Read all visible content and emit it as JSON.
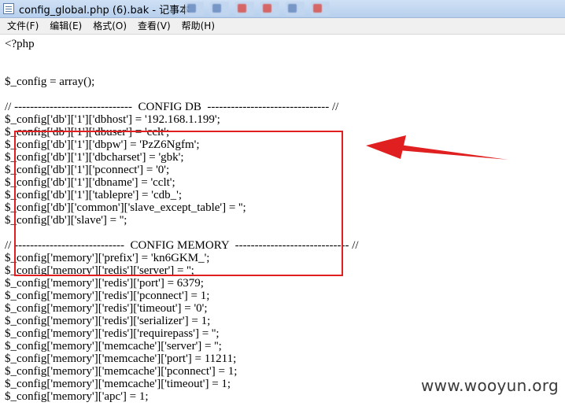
{
  "window": {
    "title": "config_global.php (6).bak - 记事本",
    "background_tabs": [
      "",
      "",
      "",
      "",
      "",
      "",
      ""
    ]
  },
  "menu": [
    "文件(F)",
    "编辑(E)",
    "格式(O)",
    "查看(V)",
    "帮助(H)"
  ],
  "code_lines": [
    "<?php",
    "",
    "",
    "$_config = array();",
    "",
    "// ------------------------------  CONFIG DB  ------------------------------- //",
    "$_config['db']['1']['dbhost'] = '192.168.1.199';",
    "$_config['db']['1']['dbuser'] = 'cclt';",
    "$_config['db']['1']['dbpw'] = 'PzZ6Ngfm';",
    "$_config['db']['1']['dbcharset'] = 'gbk';",
    "$_config['db']['1']['pconnect'] = '0';",
    "$_config['db']['1']['dbname'] = 'cclt';",
    "$_config['db']['1']['tablepre'] = 'cdb_';",
    "$_config['db']['common']['slave_except_table'] = '';",
    "$_config['db']['slave'] = '';",
    "",
    "// ----------------------------  CONFIG MEMORY  ----------------------------- //",
    "$_config['memory']['prefix'] = 'kn6GKM_';",
    "$_config['memory']['redis']['server'] = '';",
    "$_config['memory']['redis']['port'] = 6379;",
    "$_config['memory']['redis']['pconnect'] = 1;",
    "$_config['memory']['redis']['timeout'] = '0';",
    "$_config['memory']['redis']['serializer'] = 1;",
    "$_config['memory']['redis']['requirepass'] = '';",
    "$_config['memory']['memcache']['server'] = '';",
    "$_config['memory']['memcache']['port'] = 11211;",
    "$_config['memory']['memcache']['pconnect'] = 1;",
    "$_config['memory']['memcache']['timeout'] = 1;",
    "$_config['memory']['apc'] = 1;"
  ],
  "watermark": "www.wooyun.org",
  "colors": {
    "annotation": "#e02020",
    "titlebar": "#b7d0ee",
    "menubar": "#f0f0f0"
  }
}
